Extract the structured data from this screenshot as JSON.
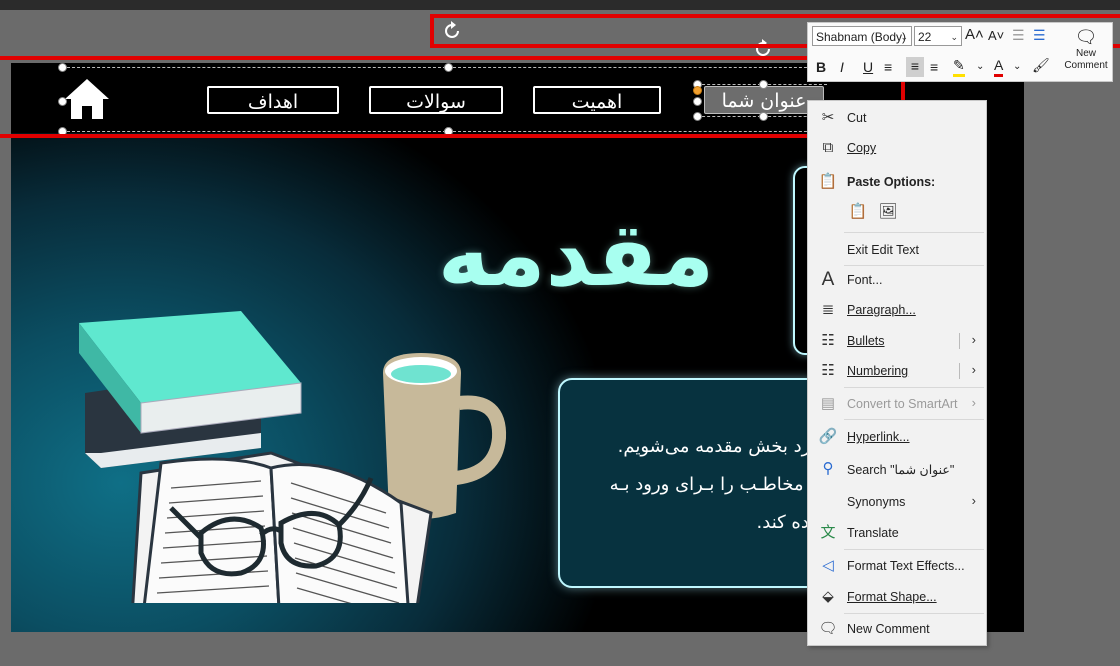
{
  "slide": {
    "nav_buttons": [
      {
        "label": "اهداف"
      },
      {
        "label": "سوالات"
      },
      {
        "label": "اهمیت"
      },
      {
        "label": "عنوان شما"
      }
    ],
    "title": "مقدمه",
    "content_lines": [
      "وارد بخش مقدمه می‌شویم.",
      "ـد مخاطـب را بـرای ورود بـه",
      "ماده کند."
    ]
  },
  "mini_toolbar": {
    "font_name": "Shabnam (Body)",
    "font_size": "22",
    "new_comment_line1": "New",
    "new_comment_line2": "Comment"
  },
  "context_menu": {
    "cut": "Cut",
    "copy": "Copy",
    "paste_options": "Paste Options:",
    "exit_edit_text": "Exit Edit Text",
    "font": "Font...",
    "paragraph": "Paragraph...",
    "bullets": "Bullets",
    "numbering": "Numbering",
    "convert_smartart": "Convert to SmartArt",
    "hyperlink": "Hyperlink...",
    "search": "Search \"عنوان شما\"",
    "synonyms": "Synonyms",
    "translate": "Translate",
    "format_text_effects": "Format Text Effects...",
    "format_shape": "Format Shape...",
    "new_comment": "New Comment"
  },
  "colors": {
    "title": "#a8fff0",
    "selection_box": "#e00000",
    "book_teal": "#5fe8cf"
  },
  "icons": [
    "home-icon",
    "cut-icon",
    "copy-icon",
    "paste-icon",
    "font-icon",
    "paragraph-icon",
    "bullets-icon",
    "numbering-icon",
    "smartart-icon",
    "hyperlink-icon",
    "search-icon",
    "translate-icon",
    "text-effects-icon",
    "format-shape-icon",
    "comment-icon",
    "rotate-icon"
  ]
}
